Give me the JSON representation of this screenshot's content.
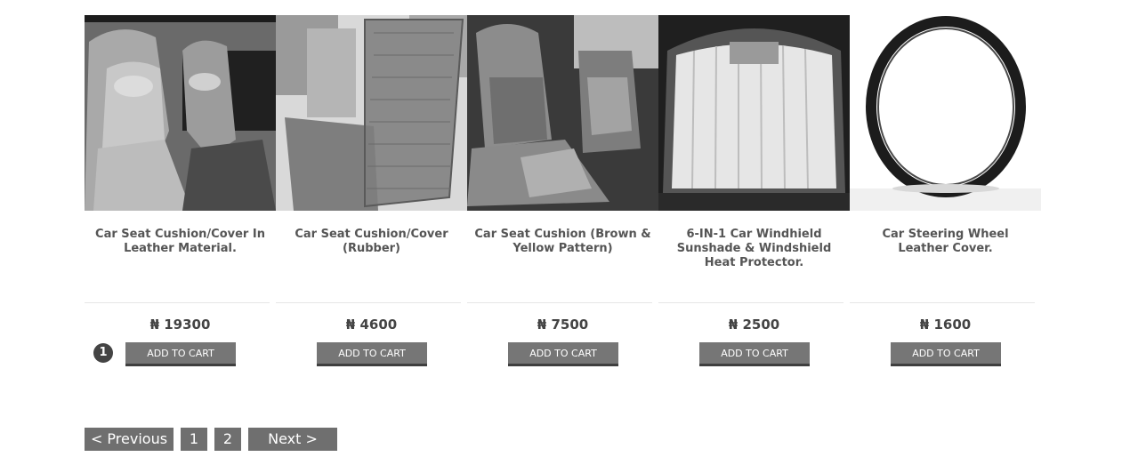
{
  "products": [
    {
      "title": "Car Seat Cushion/Cover In Leather Material.",
      "price": "₦ 19300",
      "button": "ADD TO CART",
      "image": "leather-seat-photo"
    },
    {
      "title": "Car Seat Cushion/Cover (Rubber)",
      "price": "₦ 4600",
      "button": "ADD TO CART",
      "image": "bead-seat-photo"
    },
    {
      "title": "Car Seat Cushion (Brown & Yellow Pattern)",
      "price": "₦ 7500",
      "button": "ADD TO CART",
      "image": "patterned-seat-photo"
    },
    {
      "title": "6-IN-1 Car Windhield Sunshade & Windshield Heat Protector.",
      "price": "₦ 2500",
      "button": "ADD TO CART",
      "image": "sunshade-photo"
    },
    {
      "title": "Car Steering Wheel Leather Cover.",
      "price": "₦ 1600",
      "button": "ADD TO CART",
      "image": "steering-cover-photo"
    }
  ],
  "cart_badge": "1",
  "pagination": {
    "previous": "< Previous",
    "pages": [
      "1",
      "2"
    ],
    "next": "Next >"
  }
}
